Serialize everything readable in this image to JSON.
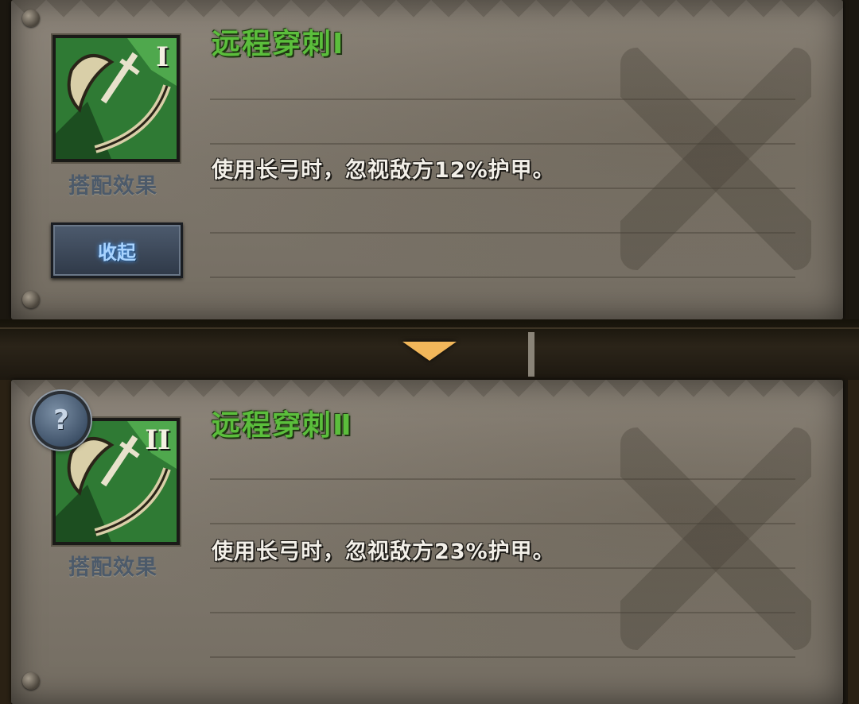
{
  "colors": {
    "title_green": "#5bbe3c",
    "desc_white": "#f2efe8",
    "button_blue_text": "#a9d4ff",
    "arrow_orange": "#f2b75a",
    "parchment": "#837b70"
  },
  "cards": [
    {
      "rank": "I",
      "title": "远程穿刺Ⅰ",
      "icon": "longbow-sword-icon",
      "combo_label": "搭配效果",
      "description": "使用长弓时，忽视敌方12%护甲。"
    },
    {
      "rank": "II",
      "title": "远程穿刺Ⅱ",
      "icon": "longbow-sword-icon",
      "combo_label": "搭配效果",
      "description": "使用长弓时，忽视敌方23%护甲。"
    }
  ],
  "collapse_button": {
    "label": "收起"
  },
  "help_button": {
    "glyph": "?",
    "icon": "question-mark-icon"
  },
  "expand_arrow": {
    "icon": "triangle-down-icon"
  }
}
